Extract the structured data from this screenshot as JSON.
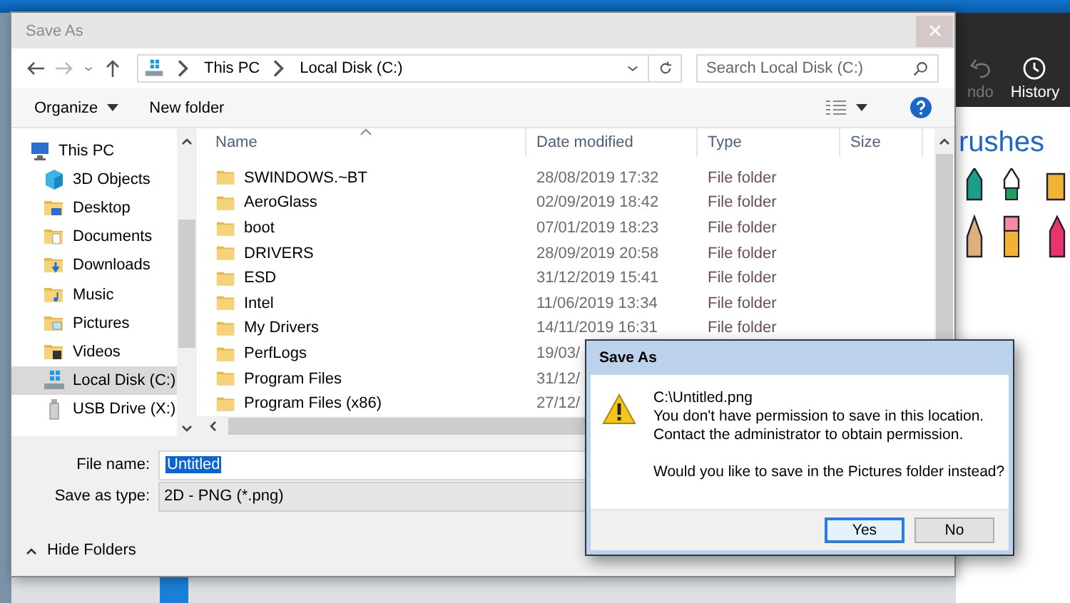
{
  "background_app": {
    "toolbar": [
      {
        "label": "ndo",
        "kind": "undo",
        "disabled": true
      },
      {
        "label": "History",
        "kind": "history",
        "disabled": false
      }
    ],
    "heading": "rushes"
  },
  "dialog": {
    "title": "Save As",
    "address": [
      "This PC",
      "Local Disk (C:)"
    ],
    "search": {
      "placeholder": "Search Local Disk (C:)"
    },
    "toolbar": {
      "organize": "Organize",
      "new_folder": "New folder"
    },
    "nav": [
      {
        "label": "This PC",
        "kind": "pc",
        "selected": false
      },
      {
        "label": "3D Objects",
        "kind": "objects3d",
        "selected": false
      },
      {
        "label": "Desktop",
        "kind": "desktop",
        "selected": false
      },
      {
        "label": "Documents",
        "kind": "documents",
        "selected": false
      },
      {
        "label": "Downloads",
        "kind": "downloads",
        "selected": false
      },
      {
        "label": "Music",
        "kind": "music",
        "selected": false
      },
      {
        "label": "Pictures",
        "kind": "pictures",
        "selected": false
      },
      {
        "label": "Videos",
        "kind": "videos",
        "selected": false
      },
      {
        "label": "Local Disk (C:)",
        "kind": "drive",
        "selected": true
      },
      {
        "label": "USB Drive (X:)",
        "kind": "usb",
        "selected": false
      }
    ],
    "columns": [
      "Name",
      "Date modified",
      "Type",
      "Size"
    ],
    "rows": [
      {
        "name": "SWINDOWS.~BT",
        "date": "28/08/2019 17:32",
        "type": "File folder"
      },
      {
        "name": "AeroGlass",
        "date": "02/09/2019 18:42",
        "type": "File folder"
      },
      {
        "name": "boot",
        "date": "07/01/2019 18:23",
        "type": "File folder"
      },
      {
        "name": "DRIVERS",
        "date": "28/09/2019 20:58",
        "type": "File folder"
      },
      {
        "name": "ESD",
        "date": "31/12/2019 15:41",
        "type": "File folder"
      },
      {
        "name": "Intel",
        "date": "11/06/2019 13:34",
        "type": "File folder"
      },
      {
        "name": "My Drivers",
        "date": "14/11/2019 16:31",
        "type": "File folder"
      },
      {
        "name": "PerfLogs",
        "date": "19/03/"
      },
      {
        "name": "Program Files",
        "date": "31/12/"
      },
      {
        "name": "Program Files (x86)",
        "date": "27/12/"
      }
    ],
    "file_name": {
      "label": "File name:",
      "value": "Untitled"
    },
    "save_type": {
      "label": "Save as type:",
      "value": "2D - PNG (*.png)"
    },
    "hide_folders": "Hide Folders"
  },
  "alert": {
    "title": "Save As",
    "lines": [
      "C:\\Untitled.png",
      "You don't have permission to save in this location.",
      "Contact the administrator to obtain permission."
    ],
    "question": "Would you like to save in the Pictures folder instead?",
    "buttons": [
      {
        "label": "Yes",
        "selected": true
      },
      {
        "label": "No",
        "selected": false
      }
    ]
  }
}
